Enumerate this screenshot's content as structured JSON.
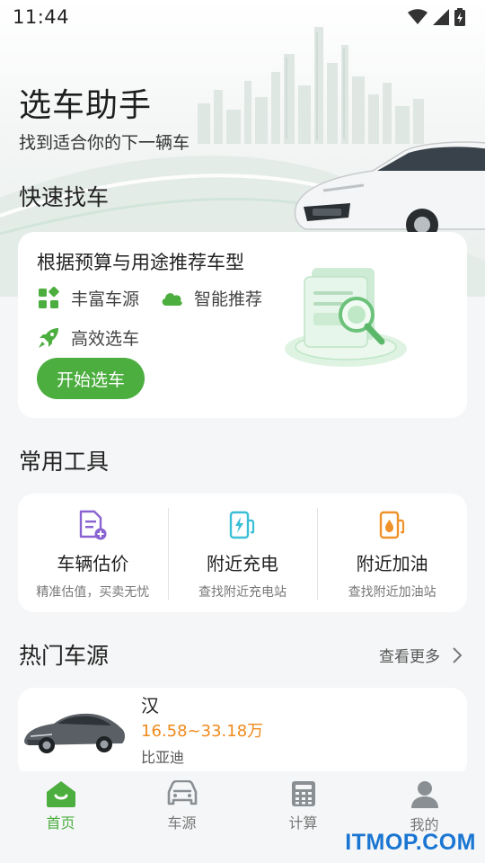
{
  "status_bar": {
    "time": "11:44",
    "icons": [
      "wifi-icon",
      "cellular-signal-icon",
      "battery-charging-icon"
    ]
  },
  "hero": {
    "title": "选车助手",
    "subtitle": "找到适合你的下一辆车"
  },
  "quick_find": {
    "section_title": "快速找车",
    "headline": "根据预算与用途推荐车型",
    "features": [
      {
        "label": "丰富车源",
        "icon": "grid-icon"
      },
      {
        "label": "智能推荐",
        "icon": "cloud-icon"
      },
      {
        "label": "高效选车",
        "icon": "rocket-icon"
      }
    ],
    "button_label": "开始选车"
  },
  "tools": {
    "section_title": "常用工具",
    "items": [
      {
        "name": "车辆估价",
        "desc": "精准估值，买卖无忧",
        "icon": "document-plus-icon"
      },
      {
        "name": "附近充电",
        "desc": "查找附近充电站",
        "icon": "charging-station-icon"
      },
      {
        "name": "附近加油",
        "desc": "查找附近加油站",
        "icon": "fuel-pump-icon"
      }
    ]
  },
  "hot_cars": {
    "section_title": "热门车源",
    "more_label": "查看更多",
    "items": [
      {
        "name": "汉",
        "price": "16.58~33.18万",
        "brand": "比亚迪"
      }
    ]
  },
  "tab_bar": {
    "items": [
      {
        "label": "首页",
        "icon": "home-icon",
        "active": true
      },
      {
        "label": "车源",
        "icon": "car-icon",
        "active": false
      },
      {
        "label": "计算",
        "icon": "calculator-icon",
        "active": false
      },
      {
        "label": "我的",
        "icon": "user-icon",
        "active": false
      }
    ]
  },
  "watermark": "ITMOP.COM",
  "colors": {
    "accent": "#4cae3f",
    "price": "#f08a1c",
    "tool_icon_purple": "#8a63d2",
    "tool_icon_teal": "#3bbfd6",
    "tool_icon_orange": "#f0922b"
  }
}
